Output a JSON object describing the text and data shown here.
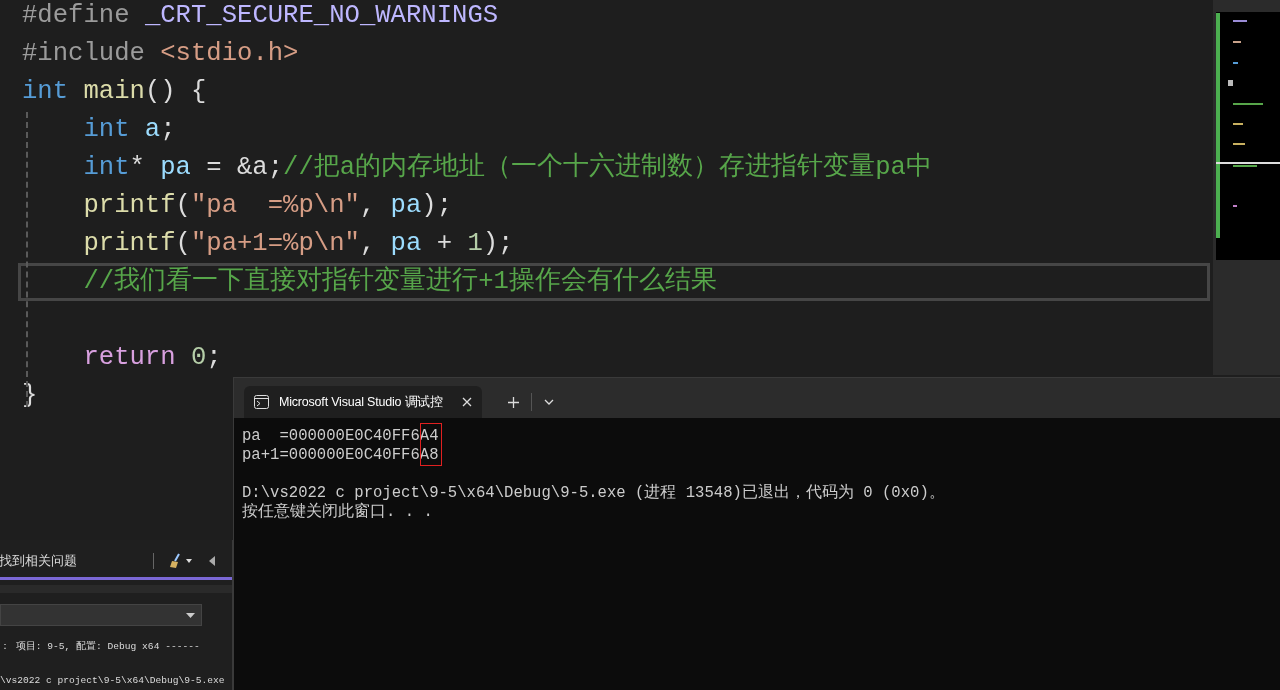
{
  "editor": {
    "lines": [
      {
        "current": false,
        "indent": false,
        "tokens": [
          {
            "kind": "pre",
            "text": "#define "
          },
          {
            "kind": "macro",
            "text": "_CRT_SECURE_NO_WARNINGS"
          }
        ]
      },
      {
        "current": false,
        "indent": false,
        "tokens": [
          {
            "kind": "pre",
            "text": "#include "
          },
          {
            "kind": "str",
            "text": "<stdio.h>"
          }
        ]
      },
      {
        "current": false,
        "indent": false,
        "tokens": [
          {
            "kind": "kw",
            "text": "int "
          },
          {
            "kind": "fn",
            "text": "main"
          },
          {
            "kind": "punct",
            "text": "() {"
          }
        ]
      },
      {
        "current": false,
        "indent": true,
        "tokens": [
          {
            "kind": "kw",
            "text": "int "
          },
          {
            "kind": "var",
            "text": "a"
          },
          {
            "kind": "punct",
            "text": ";"
          }
        ]
      },
      {
        "current": false,
        "indent": true,
        "tokens": [
          {
            "kind": "kw",
            "text": "int"
          },
          {
            "kind": "punct",
            "text": "* "
          },
          {
            "kind": "var",
            "text": "pa"
          },
          {
            "kind": "punct",
            "text": " = &a;"
          },
          {
            "kind": "comment",
            "text": "//把a的内存地址（一个十六进制数）存进指针变量pa中"
          }
        ]
      },
      {
        "current": false,
        "indent": true,
        "tokens": [
          {
            "kind": "fn",
            "text": "printf"
          },
          {
            "kind": "punct",
            "text": "("
          },
          {
            "kind": "str",
            "text": "\"pa  =%p\\n\""
          },
          {
            "kind": "punct",
            "text": ", "
          },
          {
            "kind": "var",
            "text": "pa"
          },
          {
            "kind": "punct",
            "text": ");"
          }
        ]
      },
      {
        "current": false,
        "indent": true,
        "tokens": [
          {
            "kind": "fn",
            "text": "printf"
          },
          {
            "kind": "punct",
            "text": "("
          },
          {
            "kind": "str",
            "text": "\"pa+1=%p\\n\""
          },
          {
            "kind": "punct",
            "text": ", "
          },
          {
            "kind": "var",
            "text": "pa"
          },
          {
            "kind": "punct",
            "text": " + "
          },
          {
            "kind": "num",
            "text": "1"
          },
          {
            "kind": "punct",
            "text": ");"
          }
        ]
      },
      {
        "current": true,
        "indent": true,
        "tokens": [
          {
            "kind": "comment",
            "text": "//我们看一下直接对指针变量进行+1操作会有什么结果"
          }
        ]
      },
      {
        "current": false
      },
      {
        "current": false,
        "indent": true,
        "tokens": [
          {
            "kind": "ctrl",
            "text": "return "
          },
          {
            "kind": "num",
            "text": "0"
          },
          {
            "kind": "punct",
            "text": ";"
          }
        ]
      },
      {
        "current": false,
        "indent": false,
        "tokens": [
          {
            "kind": "punct",
            "text": "}"
          }
        ]
      }
    ]
  },
  "side_panel": {
    "search_text": "找到相关问题",
    "output_lines": [
      "： 项目: 9-5, 配置: Debug x64 ------",
      "\\vs2022 c project\\9-5\\x64\\Debug\\9-5.exe"
    ]
  },
  "terminal": {
    "tab_title": "Microsoft Visual Studio 调试控",
    "output_blocks": [
      [
        "pa  =000000E0C40FF6A4",
        "pa+1=000000E0C40FF6A8"
      ],
      [
        "D:\\vs2022 c project\\9-5\\x64\\Debug\\9-5.exe (进程 13548)已退出，代码为 0 (0x0)。",
        "按任意键关闭此窗口. . ."
      ]
    ]
  }
}
